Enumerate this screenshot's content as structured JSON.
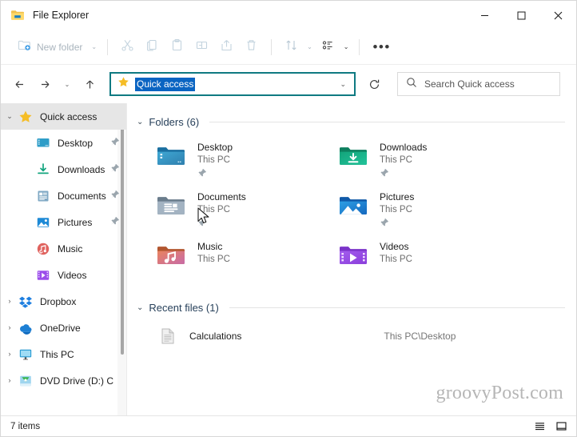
{
  "window": {
    "title": "File Explorer",
    "icon": "folder-icon",
    "controls": {
      "minimize": "─",
      "maximize": "☐",
      "close": "✕"
    }
  },
  "toolbar": {
    "new_folder_label": "New folder",
    "new_folder_caret": "⌄",
    "items": [
      {
        "name": "cut-icon",
        "label": "Cut"
      },
      {
        "name": "copy-icon",
        "label": "Copy"
      },
      {
        "name": "paste-icon",
        "label": "Paste"
      },
      {
        "name": "rename-icon",
        "label": "Rename"
      },
      {
        "name": "share-icon",
        "label": "Share"
      },
      {
        "name": "delete-icon",
        "label": "Delete"
      }
    ],
    "sort_label": "Sort",
    "view_label": "View",
    "more_label": "See more"
  },
  "address": {
    "back": "←",
    "forward": "→",
    "recent": "⌄",
    "up": "↑",
    "icon": "star-icon",
    "value": "Quick access",
    "dropdown_caret": "⌄",
    "refresh_label": "Refresh",
    "selected": true
  },
  "search": {
    "placeholder": "Search Quick access",
    "icon": "search-icon"
  },
  "sidebar": {
    "items": [
      {
        "label": "Quick access",
        "icon": "star-icon",
        "twisty": "⌄",
        "selected": true,
        "indent": false,
        "pinned": false
      },
      {
        "label": "Desktop",
        "icon": "desktop-icon",
        "twisty": "",
        "selected": false,
        "indent": true,
        "pinned": true
      },
      {
        "label": "Downloads",
        "icon": "downloads-icon",
        "twisty": "",
        "selected": false,
        "indent": true,
        "pinned": true
      },
      {
        "label": "Documents",
        "icon": "documents-icon",
        "twisty": "",
        "selected": false,
        "indent": true,
        "pinned": true
      },
      {
        "label": "Pictures",
        "icon": "pictures-icon",
        "twisty": "",
        "selected": false,
        "indent": true,
        "pinned": true
      },
      {
        "label": "Music",
        "icon": "music-icon",
        "twisty": "",
        "selected": false,
        "indent": true,
        "pinned": false
      },
      {
        "label": "Videos",
        "icon": "videos-icon",
        "twisty": "",
        "selected": false,
        "indent": true,
        "pinned": false
      },
      {
        "label": "Dropbox",
        "icon": "dropbox-icon",
        "twisty": "›",
        "selected": false,
        "indent": false,
        "pinned": false
      },
      {
        "label": "OneDrive",
        "icon": "onedrive-icon",
        "twisty": "›",
        "selected": false,
        "indent": false,
        "pinned": false
      },
      {
        "label": "This PC",
        "icon": "thispc-icon",
        "twisty": "›",
        "selected": false,
        "indent": false,
        "pinned": false
      },
      {
        "label": "DVD Drive (D:) C",
        "icon": "dvd-icon",
        "twisty": "›",
        "selected": false,
        "indent": false,
        "pinned": false
      }
    ]
  },
  "content": {
    "folders_group": {
      "caret": "⌄",
      "title": "Folders (6)",
      "tiles": [
        {
          "name": "Desktop",
          "sub": "This PC",
          "icon": "folder-desktop-icon",
          "pinned": true
        },
        {
          "name": "Downloads",
          "sub": "This PC",
          "icon": "folder-downloads-icon",
          "pinned": true
        },
        {
          "name": "Documents",
          "sub": "This PC",
          "icon": "folder-documents-icon",
          "pinned": true
        },
        {
          "name": "Pictures",
          "sub": "This PC",
          "icon": "folder-pictures-icon",
          "pinned": true
        },
        {
          "name": "Music",
          "sub": "This PC",
          "icon": "folder-music-icon",
          "pinned": false
        },
        {
          "name": "Videos",
          "sub": "This PC",
          "icon": "folder-videos-icon",
          "pinned": false
        }
      ]
    },
    "recent_group": {
      "caret": "⌄",
      "title": "Recent files (1)",
      "files": [
        {
          "name": "Calculations",
          "path": "This PC\\Desktop",
          "icon": "document-icon"
        }
      ]
    },
    "watermark": "groovyPost.com"
  },
  "statusbar": {
    "item_count": "7 items",
    "views": [
      {
        "name": "details-view-icon",
        "label": "Details view"
      },
      {
        "name": "large-icons-view-icon",
        "label": "Large icons view"
      }
    ]
  },
  "colors": {
    "accent": "#0a64c2",
    "focus_border": "#0f7a82",
    "star": "#f5bd26",
    "group_title": "#27405a"
  }
}
